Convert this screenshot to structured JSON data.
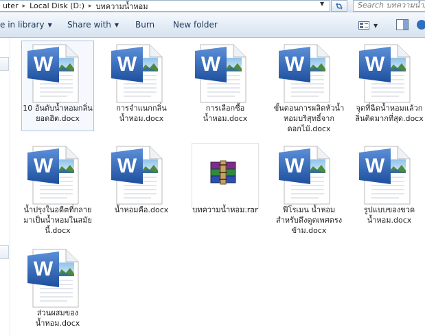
{
  "address_bar": {
    "crumbs": [
      "uter",
      "Local Disk (D:)",
      "บทความน้ำหอม"
    ],
    "search_placeholder": "Search บทความน้ำ..."
  },
  "toolbar": {
    "include_in_library": "e in library",
    "share_with": "Share with",
    "burn": "Burn",
    "new_folder": "New folder"
  },
  "files": [
    {
      "name": "10  อันดับน้ำหอมกลิ่นยอดฮิต.docx",
      "type": "docx-icon",
      "selected": true
    },
    {
      "name": "การจำแนกกลิ่น น้ำหอม.docx",
      "type": "docx-icon"
    },
    {
      "name": "การเลือกซื้อน้ำหอม.docx",
      "type": "docx-icon"
    },
    {
      "name": "ขั้นตอนการผลิตหัวน้ำหอมบริสุทธิ์จากดอกไม้.docx",
      "type": "docx-icon"
    },
    {
      "name": "จุดที่ฉีดน้ำหอมแล้วกลิ่นติดมากที่สุด.docx",
      "type": "docx-icon"
    },
    {
      "name": "น้ำปรุงในอดีตที่กลายมาเป็นน้ำหอมในสมัยนี้.docx",
      "type": "docx-icon"
    },
    {
      "name": "น้ำหอมคือ.docx",
      "type": "docx-icon"
    },
    {
      "name": "บทความน้ำหอม.rar",
      "type": "rar-icon"
    },
    {
      "name": "ฟีโรเมน น้ำหอมสำหรับดึงดูดเพศตรงข้าม.docx",
      "type": "docx-icon"
    },
    {
      "name": "รูปแบบของขวดน้ำหอม.docx",
      "type": "docx-icon"
    },
    {
      "name": "ส่วนผสมของน้ำหอม.docx",
      "type": "docx-icon"
    }
  ],
  "colors": {
    "word_blue": "#2b5fb4",
    "toolbar_text": "#1e395b",
    "selection_border": "#a5c4e6"
  }
}
